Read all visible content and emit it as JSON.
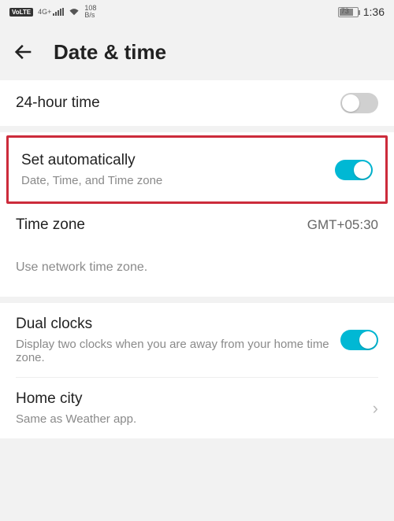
{
  "statusbar": {
    "volte": "VoLTE",
    "net_type": "4G+",
    "speed_value": "108",
    "speed_unit": "B/s",
    "battery_percent": "73",
    "clock": "1:36"
  },
  "header": {
    "title": "Date & time"
  },
  "rows": {
    "r24h": {
      "label": "24-hour time",
      "on": false
    },
    "auto": {
      "label": "Set automatically",
      "sub": "Date, Time, and Time zone",
      "on": true
    },
    "tz": {
      "label": "Time zone",
      "value": "GMT+05:30"
    },
    "tz_hint": "Use network time zone.",
    "dual": {
      "label": "Dual clocks",
      "sub": "Display two clocks when you are away from your home time zone.",
      "on": true
    },
    "home": {
      "label": "Home city",
      "sub": "Same as Weather app."
    }
  }
}
